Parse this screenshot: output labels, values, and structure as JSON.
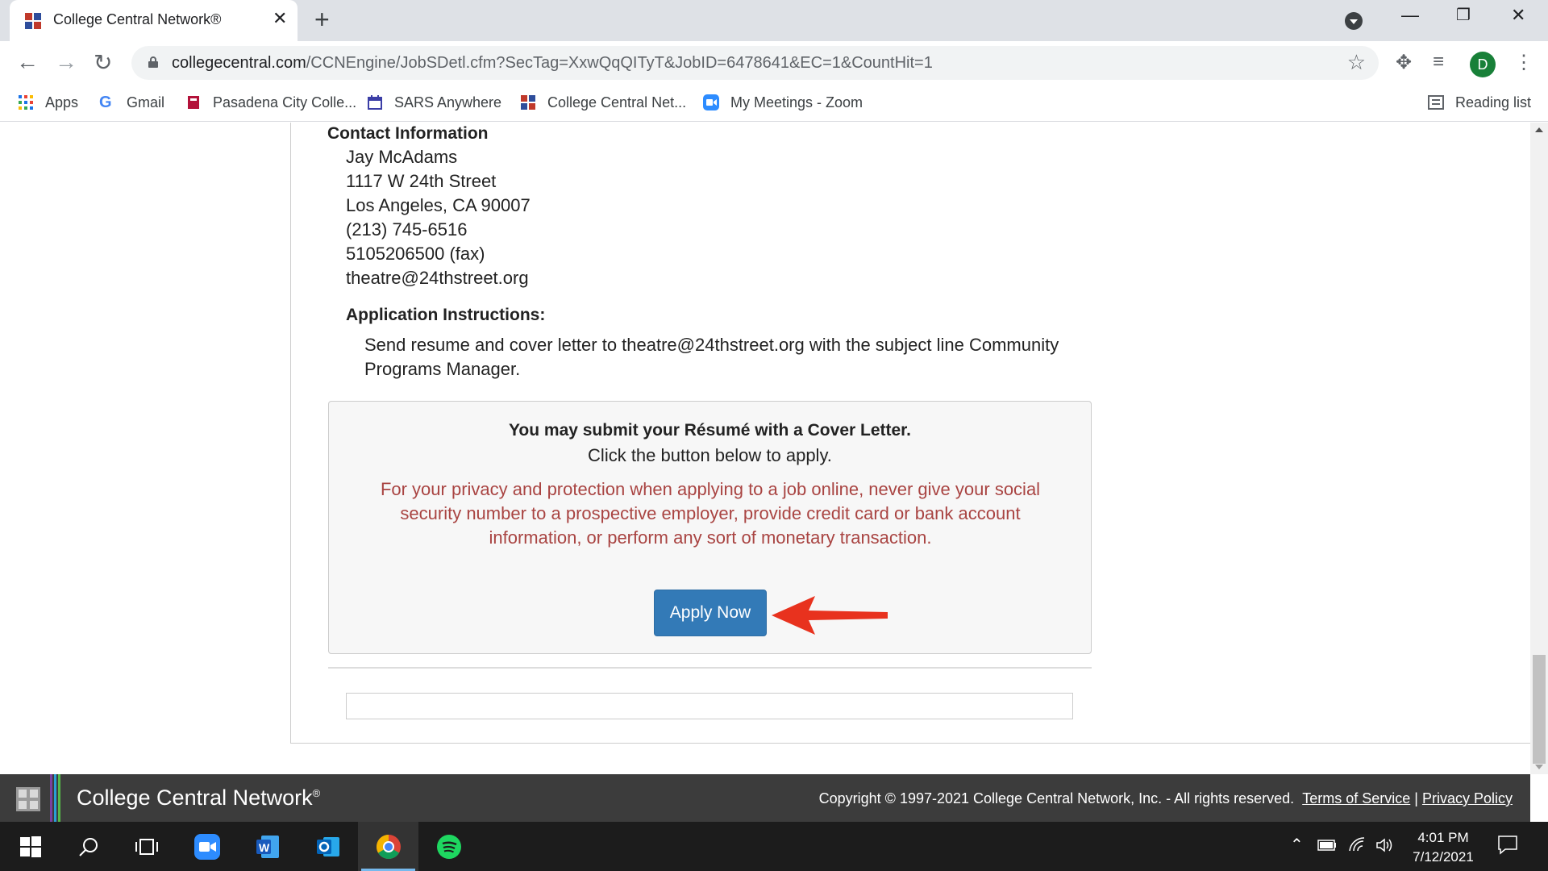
{
  "browser": {
    "tab_title": "College Central Network®",
    "url_host": "collegecentral.com",
    "url_path": "/CCNEngine/JobSDetl.cfm?SecTag=XxwQqQITyT&JobID=6478641&EC=1&CountHit=1",
    "profile_initial": "D",
    "bookmarks": [
      {
        "label": "Apps",
        "icon": "apps-grid-icon"
      },
      {
        "label": "Gmail",
        "icon": "google-icon"
      },
      {
        "label": "Pasadena City Colle...",
        "icon": "pcc-icon"
      },
      {
        "label": "SARS Anywhere",
        "icon": "calendar-icon"
      },
      {
        "label": "College Central Net...",
        "icon": "ccn-icon"
      },
      {
        "label": "My Meetings - Zoom",
        "icon": "zoom-icon"
      }
    ],
    "reading_list": "Reading list"
  },
  "contact": {
    "heading": "Contact Information",
    "name": "Jay McAdams",
    "address1": "1117 W 24th Street",
    "address2": "Los Angeles, CA 90007",
    "phone": "(213) 745-6516",
    "fax": "5105206500 (fax)",
    "email": "theatre@24thstreet.org"
  },
  "application": {
    "heading": "Application Instructions:",
    "text": "Send resume and cover letter to theatre@24thstreet.org with the subject line Community Programs Manager."
  },
  "apply_box": {
    "bold_line": "You may submit your Résumé with a Cover Letter.",
    "sub_line": "Click the button below to apply.",
    "privacy": "For your privacy and protection when applying to a job online, never give your social security number to a prospective employer, provide credit card or bank account information, or perform any sort of monetary transaction.",
    "button": "Apply Now",
    "arrow_color": "#e8321e"
  },
  "footer": {
    "brand": "College Central Network",
    "brand_mark": "®",
    "copyright": "Copyright © 1997-2021 College Central Network, Inc. - All rights reserved.",
    "terms": "Terms of Service",
    "separator": "|",
    "privacy": "Privacy Policy"
  },
  "taskbar": {
    "time": "4:01 PM",
    "date": "7/12/2021",
    "apps": [
      "start-icon",
      "search-icon",
      "task-view-icon",
      "zoom-icon",
      "word-icon",
      "outlook-icon",
      "chrome-icon",
      "spotify-icon"
    ]
  },
  "colors": {
    "accent_button": "#337ab7",
    "warning_text": "#a94442",
    "footer_bg": "#3c3c3c"
  }
}
